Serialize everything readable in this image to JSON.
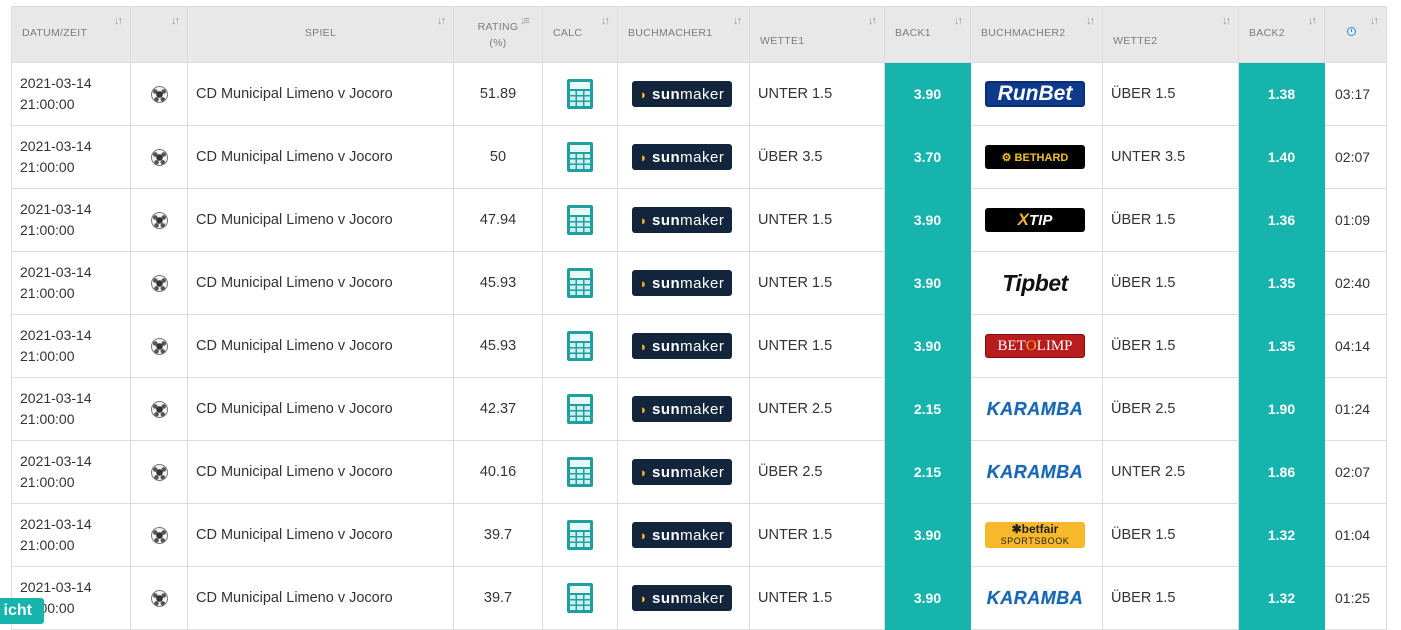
{
  "headers": {
    "datum_zeit": "DATUM/ZEIT",
    "spiel": "SPIEL",
    "rating_line1": "RATING",
    "rating_line2": "(%)",
    "calc": "CALC",
    "buchmacher1": "BUCHMACHER1",
    "wette1": "WETTE1",
    "back1": "BACK1",
    "buchmacher2": "BUCHMACHER2",
    "wette2": "WETTE2",
    "back2": "BACK2"
  },
  "icons": {
    "sort": "sort-arrows-icon",
    "rating_sort": "sort-descending-icon",
    "time": "clock-icon",
    "sport": "soccer-ball-icon",
    "calc": "calculator-icon"
  },
  "colors": {
    "accent": "#17b3ad",
    "header_bg": "#e8e8e8"
  },
  "logos": {
    "sunmaker": {
      "a": "sun",
      "b": "maker"
    },
    "runbet": {
      "a": "RunBet"
    },
    "bethard": {
      "a": "⚙ BETHARD"
    },
    "xtip": {
      "a": "X",
      "b": "TIP"
    },
    "tipbet": {
      "a": "Tipbet"
    },
    "betolimp": {
      "a": "BET",
      "b": "O",
      "c": "LIMP"
    },
    "karamba": {
      "a": "KARAMBA"
    },
    "betfair": {
      "a": "✱betfair",
      "b": "SPORTSBOOK"
    }
  },
  "rows": [
    {
      "date": "2021-03-14",
      "time": "21:00:00",
      "game": "CD Municipal Limeno v Jocoro",
      "rating": "51.89",
      "bm1": "sunmaker",
      "bet1": "UNTER 1.5",
      "back1": "3.90",
      "bm2": "runbet",
      "bet2": "ÜBER 1.5",
      "back2": "1.38",
      "age": "03:17"
    },
    {
      "date": "2021-03-14",
      "time": "21:00:00",
      "game": "CD Municipal Limeno v Jocoro",
      "rating": "50",
      "bm1": "sunmaker",
      "bet1": "ÜBER 3.5",
      "back1": "3.70",
      "bm2": "bethard",
      "bet2": "UNTER 3.5",
      "back2": "1.40",
      "age": "02:07"
    },
    {
      "date": "2021-03-14",
      "time": "21:00:00",
      "game": "CD Municipal Limeno v Jocoro",
      "rating": "47.94",
      "bm1": "sunmaker",
      "bet1": "UNTER 1.5",
      "back1": "3.90",
      "bm2": "xtip",
      "bet2": "ÜBER 1.5",
      "back2": "1.36",
      "age": "01:09"
    },
    {
      "date": "2021-03-14",
      "time": "21:00:00",
      "game": "CD Municipal Limeno v Jocoro",
      "rating": "45.93",
      "bm1": "sunmaker",
      "bet1": "UNTER 1.5",
      "back1": "3.90",
      "bm2": "tipbet",
      "bet2": "ÜBER 1.5",
      "back2": "1.35",
      "age": "02:40"
    },
    {
      "date": "2021-03-14",
      "time": "21:00:00",
      "game": "CD Municipal Limeno v Jocoro",
      "rating": "45.93",
      "bm1": "sunmaker",
      "bet1": "UNTER 1.5",
      "back1": "3.90",
      "bm2": "betolimp",
      "bet2": "ÜBER 1.5",
      "back2": "1.35",
      "age": "04:14"
    },
    {
      "date": "2021-03-14",
      "time": "21:00:00",
      "game": "CD Municipal Limeno v Jocoro",
      "rating": "42.37",
      "bm1": "sunmaker",
      "bet1": "UNTER 2.5",
      "back1": "2.15",
      "bm2": "karamba",
      "bet2": "ÜBER 2.5",
      "back2": "1.90",
      "age": "01:24"
    },
    {
      "date": "2021-03-14",
      "time": "21:00:00",
      "game": "CD Municipal Limeno v Jocoro",
      "rating": "40.16",
      "bm1": "sunmaker",
      "bet1": "ÜBER 2.5",
      "back1": "2.15",
      "bm2": "karamba",
      "bet2": "UNTER 2.5",
      "back2": "1.86",
      "age": "02:07"
    },
    {
      "date": "2021-03-14",
      "time": "21:00:00",
      "game": "CD Municipal Limeno v Jocoro",
      "rating": "39.7",
      "bm1": "sunmaker",
      "bet1": "UNTER 1.5",
      "back1": "3.90",
      "bm2": "betfair",
      "bet2": "ÜBER 1.5",
      "back2": "1.32",
      "age": "01:04"
    },
    {
      "date": "2021-03-14",
      "time": "21:00:00",
      "game": "CD Municipal Limeno v Jocoro",
      "rating": "39.7",
      "bm1": "sunmaker",
      "bet1": "UNTER 1.5",
      "back1": "3.90",
      "bm2": "karamba",
      "bet2": "ÜBER 1.5",
      "back2": "1.32",
      "age": "01:25"
    }
  ],
  "side_tab": {
    "label": "icht"
  }
}
